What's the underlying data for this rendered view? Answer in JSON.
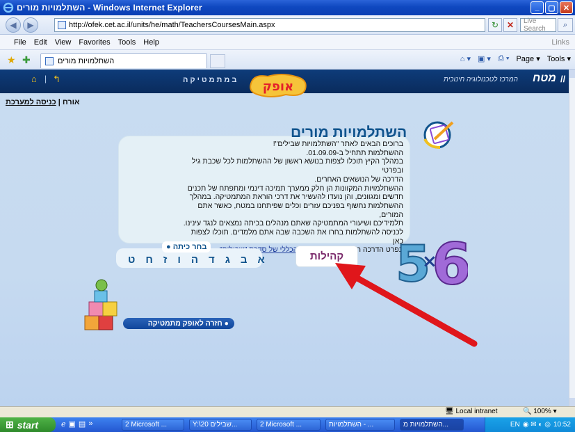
{
  "window": {
    "title": "השתלמויות מורים - Windows Internet Explorer",
    "buttons": [
      "_",
      "▢",
      "✕"
    ]
  },
  "address": {
    "url": "http://ofek.cet.ac.il/units/he/math/TeachersCoursesMain.aspx",
    "search_placeholder": "Live Search"
  },
  "menu": {
    "items": [
      "File",
      "Edit",
      "View",
      "Favorites",
      "Tools",
      "Help"
    ],
    "links": "Links"
  },
  "tabs": {
    "active_tab": "השתלמויות מורים",
    "commands": {
      "page": "Page",
      "tools": "Tools"
    }
  },
  "header": {
    "subject": "במתמטיקה",
    "logo_text": "אופק",
    "center": "המרכז לטכנולוגיה חינוכית",
    "matach": "מטח"
  },
  "user": {
    "guest": "אורח",
    "separator": "|",
    "login": "כניסה למערכת"
  },
  "panel": {
    "title": "השתלמויות מורים",
    "lines": [
      "ברוכים הבאים לאתר \"השתלמויות שבילים\"!",
      "ההשתלמות תתחיל ב-01.09.09.",
      "במהלך הקיץ תוכלו לצפות בנושא ראשון של ההשתלמות לכל שכבת גיל ובפרטי",
      "הדרכה של הנושאים האחרים.",
      "ההשתלמויות המקוונות הן חלק ממערך תמיכה דינמי ומתפתח של תכנים",
      "חדשים ומגוונים, והן נועדו להעשיר את דרכי הוראת המתמטיקה. במהלך",
      "ההשתלמות נחשוף בפניכם עזרים וכלים שפיתחנו במטח, כאשר אתם המורים,",
      "תלמידיכם ושיעורי המתמטיקה שאתם מנהלים בכיתה נמצאים לנגד עינינו.",
      "לכניסה להשתלמות בחרו את השכבה שבה אתם מלמדים. תוכלו לצפות כאן"
    ],
    "last_line_prefix": "בפרט הדרכה המסביר את",
    "last_line_link": "הרציונל הכללי של סדרת \"שבילים\""
  },
  "grade": {
    "label": "בחר כיתה",
    "letters": [
      "א",
      "ב",
      "ג",
      "ד",
      "ה",
      "ו",
      "ז",
      "ח",
      "ט"
    ]
  },
  "community_button": "קהילות",
  "back_button": "חזרה לאופק מתמטיקה",
  "numbers_art": {
    "left": "5",
    "op": "×",
    "right": "6"
  },
  "status": {
    "zone": "Local intranet",
    "zoom": "100%"
  },
  "taskbar": {
    "start": "start",
    "items": [
      "2 Microsoft ...",
      "Y:\\20 שבילים...",
      "2 Microsoft ...",
      "השתלמויות - ...",
      "השתלמויות מ..."
    ],
    "lang": "EN",
    "clock": "10:52"
  },
  "colors": {
    "page_bg": "#c9dcf1",
    "header_bg": "#0e3c7a",
    "title_blue": "#11548d",
    "arrow_red": "#e0161b",
    "community_purple": "#7a2a6b"
  }
}
